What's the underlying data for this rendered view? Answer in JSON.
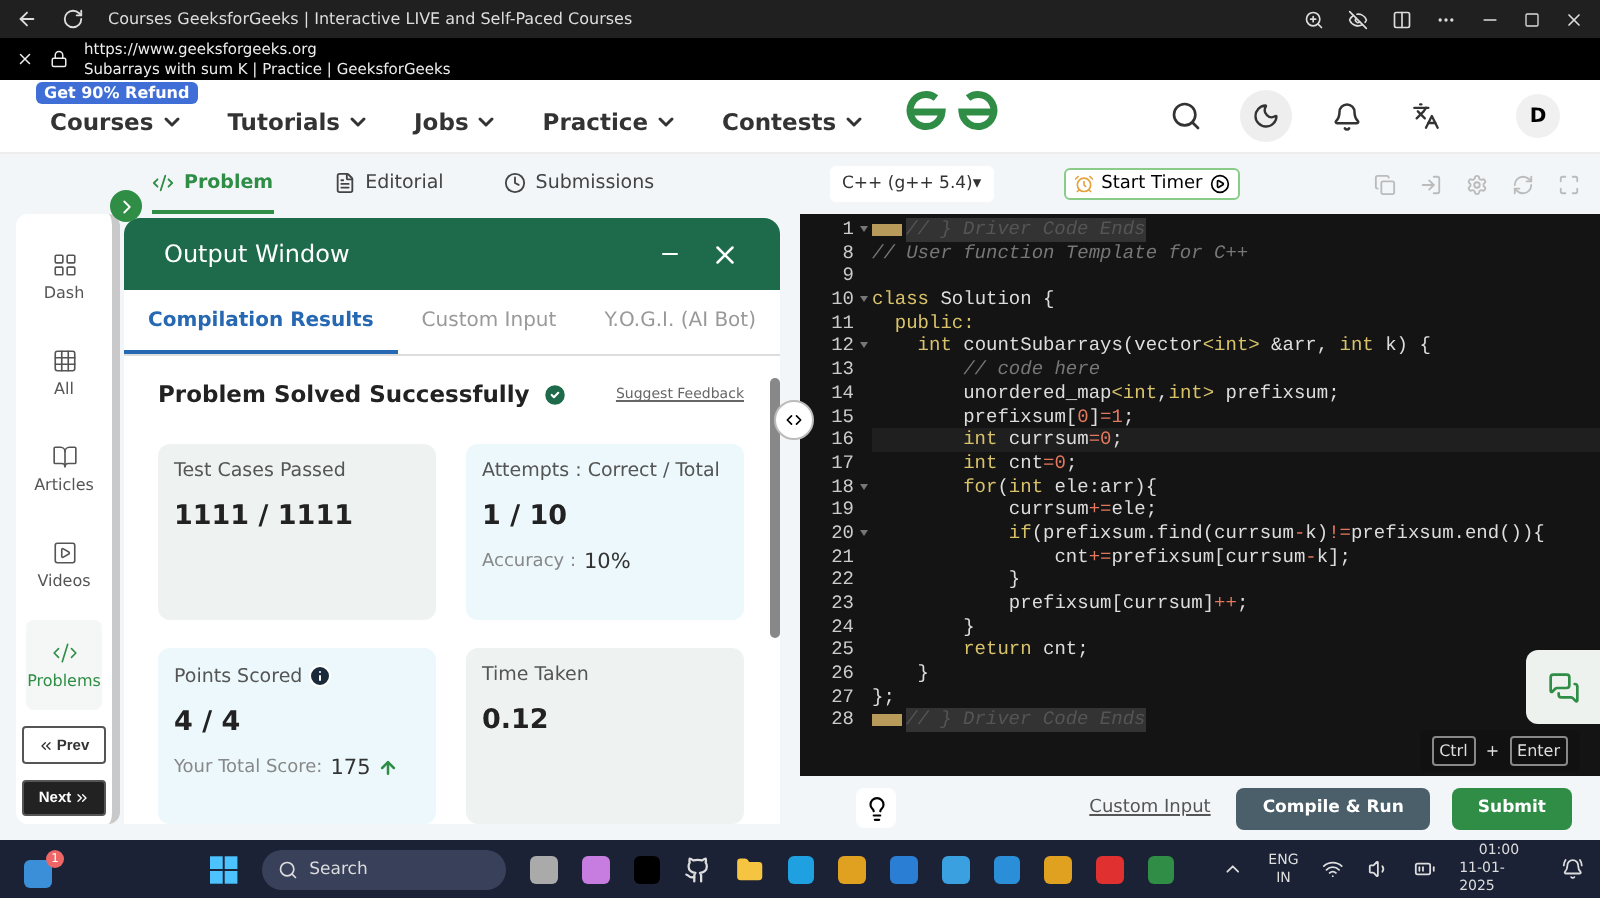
{
  "browser": {
    "title": "Courses GeeksforGeeks | Interactive LIVE and Self-Paced Courses",
    "url": "https://www.geeksforgeeks.org",
    "page_title": "Subarrays with sum K | Practice | GeeksforGeeks"
  },
  "nav": {
    "badge": "Get 90% Refund",
    "items": [
      "Courses",
      "Tutorials",
      "Jobs",
      "Practice",
      "Contests"
    ],
    "avatar": "D"
  },
  "problem_tabs": [
    {
      "label": "Problem",
      "selected": true,
      "kind": "code"
    },
    {
      "label": "Editorial",
      "selected": false,
      "kind": "doc"
    },
    {
      "label": "Submissions",
      "selected": false,
      "kind": "clock"
    }
  ],
  "editor_toolbar": {
    "language": "C++ (g++ 5.4)▾",
    "timer": "Start Timer"
  },
  "sidebar": [
    {
      "label": "Dash",
      "kind": "dash",
      "selected": false
    },
    {
      "label": "All",
      "kind": "all",
      "selected": false
    },
    {
      "label": "Articles",
      "kind": "articles",
      "selected": false
    },
    {
      "label": "Videos",
      "kind": "videos",
      "selected": false
    },
    {
      "label": "Problems",
      "kind": "problems",
      "selected": true
    }
  ],
  "pager": [
    "Prev",
    "Next"
  ],
  "output_window": {
    "title": "Output Window",
    "tabs": [
      {
        "label": "Compilation Results",
        "selected": true
      },
      {
        "label": "Custom Input",
        "selected": false
      },
      {
        "label": "Y.O.G.I. (AI Bot)",
        "selected": false
      }
    ],
    "status": "Problem Solved Successfully",
    "feedback": "Suggest Feedback",
    "cards": [
      {
        "label": "Test Cases Passed",
        "value": "1111 / 1111",
        "color": "#eef3f1"
      },
      {
        "label": "Attempts : Correct / Total",
        "value": "1 / 10",
        "note": "Accuracy :",
        "note_value": "10%",
        "color": "#ecf8fb"
      },
      {
        "label": "Points Scored",
        "value": "4 / 4",
        "note": "Your Total Score:",
        "note_value": "175",
        "info": true,
        "trend_up": true,
        "color": "#ecf8fb"
      },
      {
        "label": "Time Taken",
        "value": "0.12",
        "color": "#eef3f1"
      }
    ]
  },
  "code": [
    {
      "num": "1",
      "folded": true,
      "foldable": true,
      "tokens": [
        {
          "kind": "folded",
          "text": "// } Driver Code Ends"
        }
      ]
    },
    {
      "num": "8",
      "tokens": [
        {
          "kind": "comment",
          "text": "// User function Template for C++"
        }
      ]
    },
    {
      "num": "9"
    },
    {
      "num": "10",
      "foldable": true,
      "tokens": [
        {
          "kind": "keyword",
          "text": "class"
        },
        {
          "kind": "plain",
          "text": " Solution {"
        }
      ]
    },
    {
      "num": "11",
      "tokens": [
        {
          "kind": "keyword",
          "text": "  public:"
        }
      ]
    },
    {
      "num": "12",
      "foldable": true,
      "tokens": [
        {
          "kind": "keyword",
          "text": "    int"
        },
        {
          "kind": "plain",
          "text": " countSubarrays(vector"
        },
        {
          "kind": "keyword",
          "text": "<int>"
        },
        {
          "kind": "plain",
          "text": " &arr, "
        },
        {
          "kind": "keyword",
          "text": "int"
        },
        {
          "kind": "plain",
          "text": " k) {"
        }
      ]
    },
    {
      "num": "13",
      "tokens": [
        {
          "kind": "comment",
          "text": "        // code here"
        }
      ]
    },
    {
      "num": "14",
      "tokens": [
        {
          "kind": "plain",
          "text": "        unordered_map"
        },
        {
          "kind": "keyword",
          "text": "<int"
        },
        {
          "kind": "plain",
          "text": ","
        },
        {
          "kind": "keyword",
          "text": "int>"
        },
        {
          "kind": "plain",
          "text": " prefixsum;"
        }
      ]
    },
    {
      "num": "15",
      "tokens": [
        {
          "kind": "plain",
          "text": "        prefixsum["
        },
        {
          "kind": "number",
          "text": "0"
        },
        {
          "kind": "plain",
          "text": "]"
        },
        {
          "kind": "operator",
          "text": "="
        },
        {
          "kind": "number",
          "text": "1"
        },
        {
          "kind": "plain",
          "text": ";"
        }
      ]
    },
    {
      "num": "16",
      "active": true,
      "tokens": [
        {
          "kind": "keyword",
          "text": "        int"
        },
        {
          "kind": "plain",
          "text": " currsum"
        },
        {
          "kind": "operator",
          "text": "="
        },
        {
          "kind": "number",
          "text": "0"
        },
        {
          "kind": "plain",
          "text": ";"
        }
      ]
    },
    {
      "num": "17",
      "tokens": [
        {
          "kind": "keyword",
          "text": "        int"
        },
        {
          "kind": "plain",
          "text": " cnt"
        },
        {
          "kind": "operator",
          "text": "="
        },
        {
          "kind": "number",
          "text": "0"
        },
        {
          "kind": "plain",
          "text": ";"
        }
      ]
    },
    {
      "num": "18",
      "foldable": true,
      "tokens": [
        {
          "kind": "keyword",
          "text": "        for"
        },
        {
          "kind": "plain",
          "text": "("
        },
        {
          "kind": "keyword",
          "text": "int"
        },
        {
          "kind": "plain",
          "text": " ele:arr){"
        }
      ]
    },
    {
      "num": "19",
      "tokens": [
        {
          "kind": "plain",
          "text": "            currsum"
        },
        {
          "kind": "operator",
          "text": "+="
        },
        {
          "kind": "plain",
          "text": "ele;"
        }
      ]
    },
    {
      "num": "20",
      "foldable": true,
      "tokens": [
        {
          "kind": "keyword",
          "text": "            if"
        },
        {
          "kind": "plain",
          "text": "(prefixsum.find(currsum"
        },
        {
          "kind": "operator",
          "text": "-"
        },
        {
          "kind": "plain",
          "text": "k)"
        },
        {
          "kind": "operator",
          "text": "!="
        },
        {
          "kind": "plain",
          "text": "prefixsum.end()){"
        }
      ]
    },
    {
      "num": "21",
      "tokens": [
        {
          "kind": "plain",
          "text": "                cnt"
        },
        {
          "kind": "operator",
          "text": "+="
        },
        {
          "kind": "plain",
          "text": "prefixsum[currsum"
        },
        {
          "kind": "operator",
          "text": "-"
        },
        {
          "kind": "plain",
          "text": "k];"
        }
      ]
    },
    {
      "num": "22",
      "tokens": [
        {
          "kind": "plain",
          "text": "            }"
        }
      ]
    },
    {
      "num": "23",
      "tokens": [
        {
          "kind": "plain",
          "text": "            prefixsum[currsum]"
        },
        {
          "kind": "operator",
          "text": "++"
        },
        {
          "kind": "plain",
          "text": ";"
        }
      ]
    },
    {
      "num": "24",
      "tokens": [
        {
          "kind": "plain",
          "text": "        }"
        }
      ]
    },
    {
      "num": "25",
      "tokens": [
        {
          "kind": "keyword",
          "text": "        return"
        },
        {
          "kind": "plain",
          "text": " cnt;"
        }
      ]
    },
    {
      "num": "26",
      "tokens": [
        {
          "kind": "plain",
          "text": "    }"
        }
      ]
    },
    {
      "num": "27",
      "tokens": [
        {
          "kind": "plain",
          "text": "};"
        }
      ]
    },
    {
      "num": "28",
      "folded": true,
      "tokens": [
        {
          "kind": "folded",
          "text": "// } Driver Code Ends"
        }
      ]
    }
  ],
  "shortcut": {
    "keys": [
      "Ctrl",
      "Enter"
    ],
    "joiner": "+"
  },
  "actions": {
    "custom_input": "Custom Input",
    "compile": "Compile & Run",
    "submit": "Submit"
  },
  "taskbar": {
    "widget_badge": "1",
    "search": "Search",
    "lang": "ENG",
    "region": "IN",
    "time": "01:00",
    "date": "11-01-2025"
  }
}
